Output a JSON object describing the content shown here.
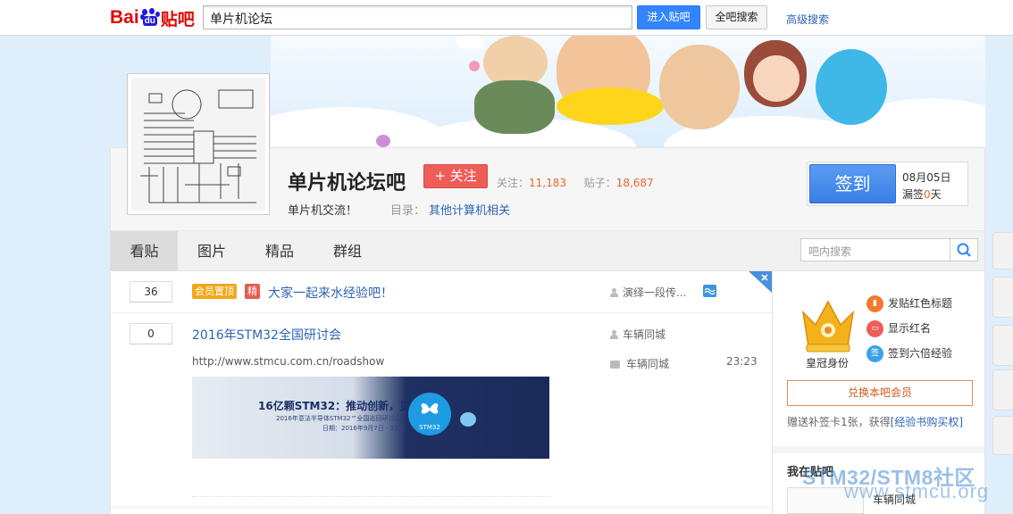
{
  "topbar": {
    "logo_bai": "Bai",
    "logo_du": "du",
    "logo_tie": "贴吧",
    "search_value": "单片机论坛",
    "enter_label": "进入贴吧",
    "all_label": "全吧搜索",
    "advanced_label": "高级搜索"
  },
  "forum": {
    "name": "单片机论坛吧",
    "follow_label": "+ 关注",
    "follow_key": "关注：",
    "follow_count": "11,183",
    "post_key": "贴子：",
    "post_count": "18,687",
    "slogan": "单片机交流！",
    "dir_key": "目录：",
    "dir_value": "其他计算机相关"
  },
  "sign": {
    "button": "签到",
    "date": "08月05日",
    "miss_prefix": "漏签",
    "miss_count": "0",
    "miss_suffix": "天"
  },
  "nav": {
    "tabs": [
      "看贴",
      "图片",
      "精品",
      "群组"
    ],
    "active": 0,
    "search_placeholder": "吧内搜索"
  },
  "threads": [
    {
      "replies": "36",
      "tags": [
        {
          "text": "会员置顶",
          "color": "#f2a71a"
        },
        {
          "text": "精",
          "color": "#e85a4f"
        }
      ],
      "title": "大家一起来水经验吧！",
      "author": "演绎一段传..."
    },
    {
      "replies": "0",
      "title": "2016年STM32全国研讨会",
      "author": "车辆同城",
      "url": "http://www.stmcu.com.cn/roadshow",
      "last_reply_author": "车辆同城",
      "last_reply_time": "23:23",
      "thumb": {
        "headline": "16亿颗STM32：推动创新，见证未来",
        "line2": "2016年意法半导体STM32™全国巡回研讨会",
        "line3": "日期：2016年9月7日 - 23日",
        "badge": "STM32"
      }
    }
  ],
  "side": {
    "crown_label": "皇冠身份",
    "perks": [
      {
        "text": "发贴红色标题",
        "icon": "bookmark-icon",
        "color": "#f07b2c",
        "glyph": "▮"
      },
      {
        "text": "显示红名",
        "icon": "name-icon",
        "color": "#ee5d58",
        "glyph": "▭"
      },
      {
        "text": "签到六倍经验",
        "icon": "sign-icon",
        "color": "#3aa2e8",
        "glyph": "签"
      }
    ],
    "exchange_label": "兑换本吧会员",
    "gift_text": "赠送补签卡1张，获得",
    "gift_link": "[经验书购买权]",
    "my_title": "我在贴吧",
    "my_name": "车辆同城"
  },
  "watermark": {
    "line1": "STM32/STM8社区",
    "line2": "www.stmcu.org"
  },
  "colors": {
    "link": "#2d64b3",
    "accent_blue": "#3385ff",
    "follow_red": "#ee5d58",
    "count_orange": "#e06b27"
  }
}
